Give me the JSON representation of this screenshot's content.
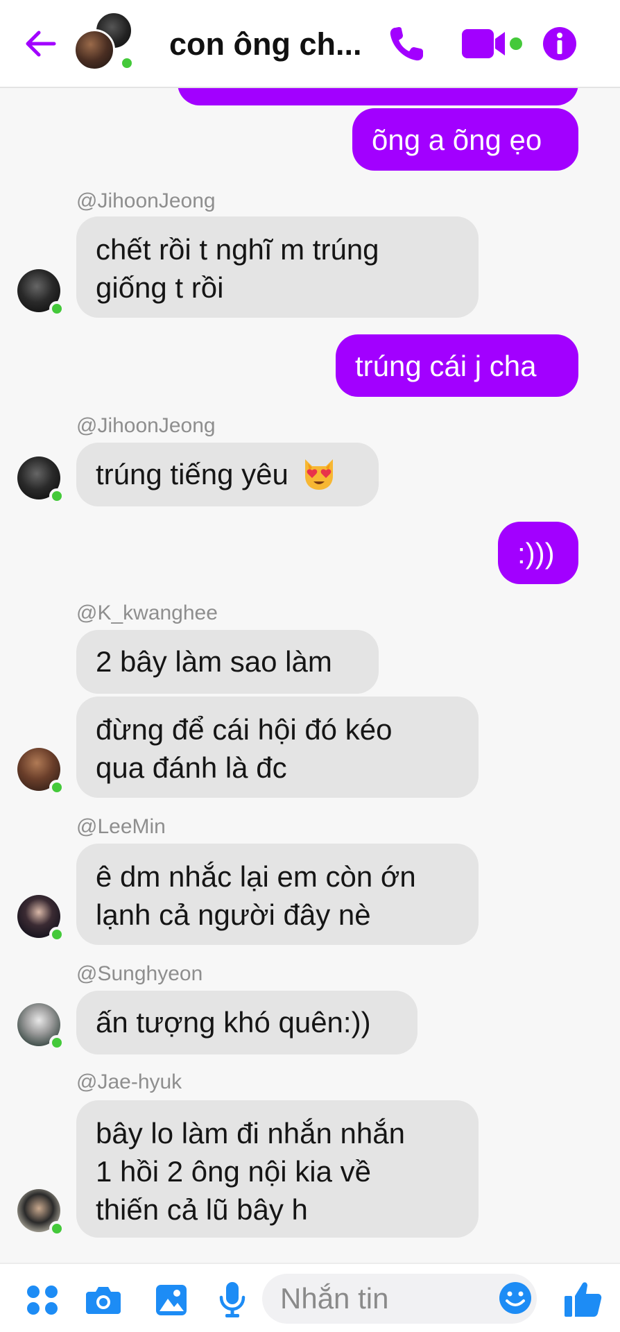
{
  "header": {
    "title": "con ông ch...",
    "colors": {
      "accent": "#a200ff",
      "online": "#44c93a"
    }
  },
  "messages": [
    {
      "id": "m0",
      "direction": "outgoing",
      "text": ""
    },
    {
      "id": "m1",
      "direction": "outgoing",
      "text": "õng a õng ẹo"
    },
    {
      "id": "m2",
      "direction": "incoming",
      "sender": "@JihoonJeong",
      "lines": [
        "chết rồi t nghĩ m trúng",
        "giống t rồi"
      ]
    },
    {
      "id": "m3",
      "direction": "outgoing",
      "text": "trúng cái j cha"
    },
    {
      "id": "m4",
      "direction": "incoming",
      "sender": "@JihoonJeong",
      "text": "trúng tiếng yêu",
      "emoji": "heart-eyes-cat-emoji"
    },
    {
      "id": "m5",
      "direction": "outgoing",
      "text": ":)))"
    },
    {
      "id": "m6",
      "direction": "incoming",
      "sender": "@K_kwanghee",
      "text": "2 bây làm sao làm"
    },
    {
      "id": "m7",
      "direction": "incoming",
      "lines": [
        "đừng để cái hội đó kéo",
        "qua đánh là đc"
      ]
    },
    {
      "id": "m8",
      "direction": "incoming",
      "sender": "@LeeMin",
      "lines": [
        "ê dm nhắc lại em còn ớn",
        "lạnh cả người đây nè"
      ]
    },
    {
      "id": "m9",
      "direction": "incoming",
      "sender": "@Sunghyeon",
      "text": "ấn tượng khó quên:))"
    },
    {
      "id": "m10",
      "direction": "incoming",
      "sender": "@Jae-hyuk",
      "lines": [
        "bây lo làm đi nhắn nhắn",
        "1 hồi 2 ông nội kia về",
        "thiến cả lũ bây h"
      ]
    }
  ],
  "composer": {
    "placeholder": "Nhắn tin",
    "icons": [
      "apps-icon",
      "camera-icon",
      "gallery-icon",
      "microphone-icon",
      "emoji-icon",
      "thumbs-up-icon"
    ]
  }
}
